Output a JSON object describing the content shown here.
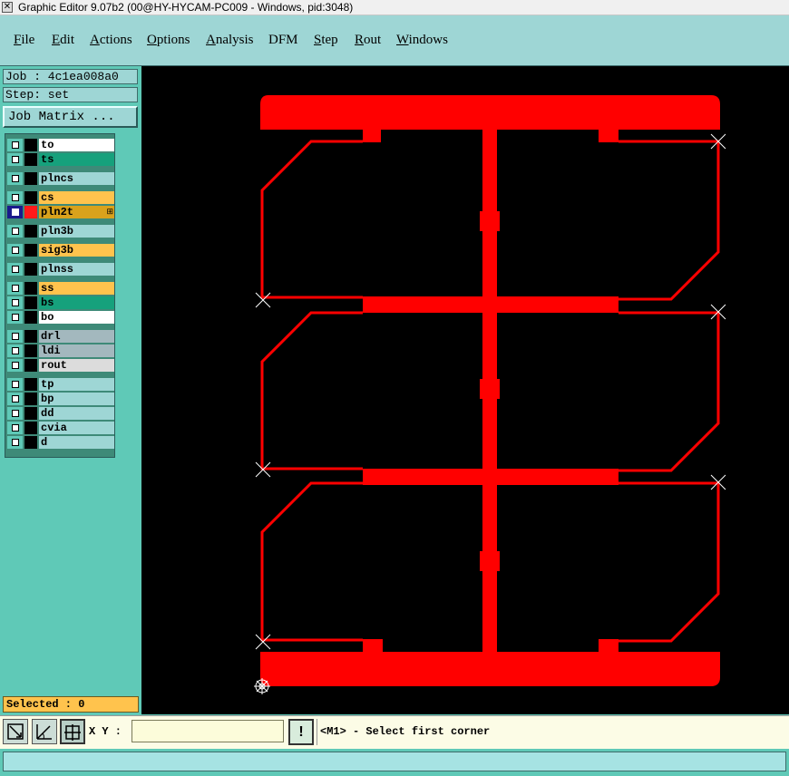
{
  "window": {
    "title": "Graphic Editor 9.07b2 (00@HY-HYCAM-PC009 - Windows, pid:3048)",
    "icon": "close-x-icon"
  },
  "menu": [
    {
      "label": "File",
      "underline": "F",
      "rest": "ile"
    },
    {
      "label": "Edit",
      "underline": "E",
      "rest": "dit"
    },
    {
      "label": "Actions",
      "underline": "A",
      "rest": "ctions"
    },
    {
      "label": "Options",
      "underline": "O",
      "rest": "ptions"
    },
    {
      "label": "Analysis",
      "underline": "A",
      "rest": "nalysis"
    },
    {
      "label": "DFM",
      "underline": "",
      "rest": "DFM"
    },
    {
      "label": "Step",
      "underline": "S",
      "rest": "tep"
    },
    {
      "label": "Rout",
      "underline": "R",
      "rest": "out"
    },
    {
      "label": "Windows",
      "underline": "W",
      "rest": "indows"
    }
  ],
  "job": {
    "text": "Job : 4c1ea008a0"
  },
  "step": {
    "text": "Step: set"
  },
  "job_matrix": {
    "label": "Job Matrix ..."
  },
  "layers": [
    {
      "name": "to",
      "bg": "#ffffff",
      "swatch": "#000000",
      "active": false
    },
    {
      "name": "ts",
      "bg": "#16a17c",
      "swatch": "#000000",
      "active": false
    },
    {
      "name": "plncs",
      "bg": "#9ed6d5",
      "swatch": "#000000",
      "active": false
    },
    {
      "name": "cs",
      "bg": "#ffc34d",
      "swatch": "#000000",
      "active": false
    },
    {
      "name": "pln2t",
      "bg": "#d9a21c",
      "swatch": "#ff1a1a",
      "active": true
    },
    {
      "name": "pln3b",
      "bg": "#9ed6d5",
      "swatch": "#000000",
      "active": false
    },
    {
      "name": "sig3b",
      "bg": "#ffc34d",
      "swatch": "#000000",
      "active": false
    },
    {
      "name": "plnss",
      "bg": "#9ed6d5",
      "swatch": "#000000",
      "active": false
    },
    {
      "name": "ss",
      "bg": "#ffc34d",
      "swatch": "#000000",
      "active": false
    },
    {
      "name": "bs",
      "bg": "#16a17c",
      "swatch": "#000000",
      "active": false
    },
    {
      "name": "bo",
      "bg": "#ffffff",
      "swatch": "#000000",
      "active": false
    },
    {
      "name": "drl",
      "bg": "#a3b8be",
      "swatch": "#000000",
      "active": false
    },
    {
      "name": "ldi",
      "bg": "#a3b8be",
      "swatch": "#000000",
      "active": false
    },
    {
      "name": "rout",
      "bg": "#dcdcdc",
      "swatch": "#000000",
      "active": false
    },
    {
      "name": "tp",
      "bg": "#9ed6d5",
      "swatch": "#000000",
      "active": false
    },
    {
      "name": "bp",
      "bg": "#9ed6d5",
      "swatch": "#000000",
      "active": false
    },
    {
      "name": "dd",
      "bg": "#9ed6d5",
      "swatch": "#000000",
      "active": false
    },
    {
      "name": "cvia",
      "bg": "#9ed6d5",
      "swatch": "#000000",
      "active": false
    },
    {
      "name": "d",
      "bg": "#9ed6d5",
      "swatch": "#000000",
      "active": false
    }
  ],
  "selected": {
    "text": "Selected : 0"
  },
  "coords": {
    "label": "X Y :",
    "value": ""
  },
  "tools": [
    {
      "name": "zoom-box-icon"
    },
    {
      "name": "measure-icon"
    },
    {
      "name": "snap-grid-icon"
    }
  ],
  "warn": {
    "label": "!"
  },
  "prompt": {
    "text": "<M1> - Select first corner"
  },
  "status": {
    "text": ""
  },
  "colors": {
    "layer_active": "#ff0000",
    "canvas": "#000000",
    "marker": "#ffffff"
  }
}
